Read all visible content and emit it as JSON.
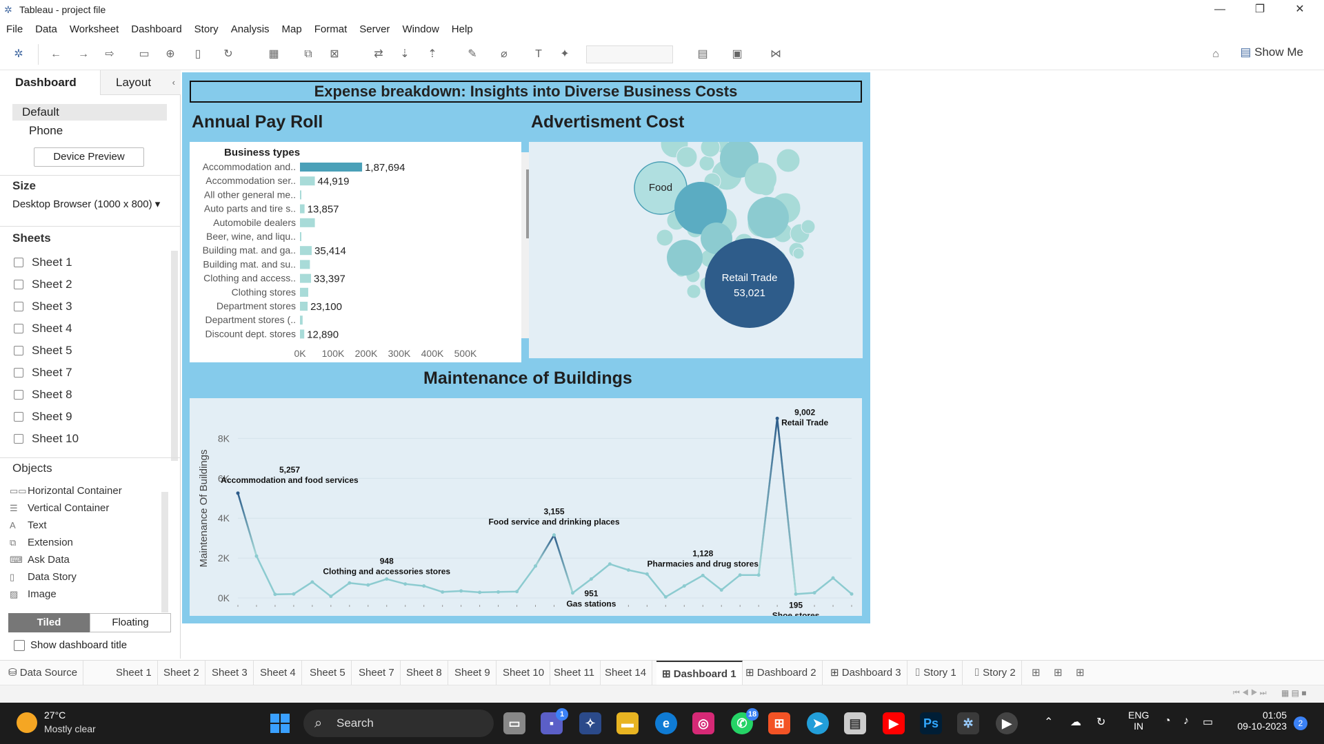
{
  "window": {
    "title": "Tableau - project file"
  },
  "menu": [
    "File",
    "Data",
    "Worksheet",
    "Dashboard",
    "Story",
    "Analysis",
    "Map",
    "Format",
    "Server",
    "Window",
    "Help"
  ],
  "toolbar": {
    "show_me": "Show Me"
  },
  "left_panel": {
    "tabs": [
      "Dashboard",
      "Layout"
    ],
    "devices": [
      "Default",
      "Phone"
    ],
    "device_preview": "Device Preview",
    "size_label": "Size",
    "size_value": "Desktop Browser (1000 x 800)",
    "sheets_label": "Sheets",
    "sheets": [
      "Sheet 1",
      "Sheet 2",
      "Sheet 3",
      "Sheet 4",
      "Sheet 5",
      "Sheet 7",
      "Sheet 8",
      "Sheet 9",
      "Sheet 10"
    ],
    "objects_label": "Objects",
    "objects": [
      {
        "icon": "horizontal-container-icon",
        "label": "Horizontal Container"
      },
      {
        "icon": "vertical-container-icon",
        "label": "Vertical Container"
      },
      {
        "icon": "text-icon",
        "label": "Text"
      },
      {
        "icon": "extension-icon",
        "label": "Extension"
      },
      {
        "icon": "ask-data-icon",
        "label": "Ask Data"
      },
      {
        "icon": "data-story-icon",
        "label": "Data Story"
      },
      {
        "icon": "image-icon",
        "label": "Image"
      }
    ],
    "tiled": "Tiled",
    "floating": "Floating",
    "show_title": "Show dashboard title"
  },
  "dashboard": {
    "title": "Expense breakdown: Insights into Diverse Business Costs",
    "chart1_title": "Annual Pay Roll",
    "chart2_title": "Advertisment Cost",
    "chart3_title": "Maintenance of Buildings"
  },
  "chart_data": [
    {
      "type": "bar",
      "title": "Annual Pay Roll",
      "header": "Business types",
      "categories": [
        "Accommodation and..",
        "Accommodation ser..",
        "All other general me..",
        "Auto parts and tire s..",
        "Automobile dealers",
        "Beer, wine, and liqu..",
        "Building mat. and ga..",
        "Building mat. and su..",
        "Clothing and access..",
        "Clothing stores",
        "Department stores",
        "Department stores (..",
        "Discount dept. stores"
      ],
      "values": [
        187694,
        44919,
        1500,
        13857,
        45000,
        500,
        35414,
        30000,
        33397,
        25000,
        23100,
        8000,
        12890
      ],
      "labels": [
        "1,87,694",
        "44,919",
        "",
        "13,857",
        "",
        "",
        "35,414",
        "",
        "33,397",
        "",
        "23,100",
        "",
        "12,890"
      ],
      "highlight_index": 0,
      "xticks": [
        "0K",
        "100K",
        "200K",
        "300K",
        "400K",
        "500K"
      ],
      "xlim": [
        0,
        500000
      ]
    },
    {
      "type": "bubble",
      "title": "Advertisment Cost",
      "labeled": [
        {
          "label": "Food",
          "value": ""
        },
        {
          "label": "Retail Trade",
          "value": "53,021"
        }
      ]
    },
    {
      "type": "line",
      "title": "Maintenance of Buildings",
      "ylabel": "Maintenance Of Buildings",
      "yticks": [
        "0K",
        "2K",
        "4K",
        "6K",
        "8K"
      ],
      "ylim": [
        0,
        9500
      ],
      "values": [
        5257,
        2100,
        180,
        200,
        800,
        80,
        750,
        650,
        948,
        700,
        600,
        300,
        350,
        280,
        300,
        320,
        1600,
        3155,
        250,
        951,
        1700,
        1400,
        1200,
        50,
        600,
        1128,
        400,
        1150,
        1150,
        9002,
        195,
        260,
        1000,
        200
      ],
      "annotations": [
        {
          "index": 0,
          "value": "5,257",
          "label": "Accommodation and food services"
        },
        {
          "index": 8,
          "value": "948",
          "label": "Clothing and accessories stores"
        },
        {
          "index": 17,
          "value": "3,155",
          "label": "Food service and drinking places"
        },
        {
          "index": 19,
          "value": "951",
          "label": "Gas stations"
        },
        {
          "index": 25,
          "value": "1,128",
          "label": "Pharmacies and drug stores"
        },
        {
          "index": 29,
          "value": "9,002",
          "label": "Retail Trade"
        },
        {
          "index": 30,
          "value": "195",
          "label": "Shoe stores"
        }
      ]
    }
  ],
  "bottom_tabs": [
    "Data Source",
    "Sheet 1",
    "Sheet 2",
    "Sheet 3",
    "Sheet 4",
    "Sheet 5",
    "Sheet 7",
    "Sheet 8",
    "Sheet 9",
    "Sheet 10",
    "Sheet 11",
    "Sheet 14",
    "Dashboard 1",
    "Dashboard 2",
    "Dashboard 3",
    "Story 1",
    "Story 2"
  ],
  "active_tab": "Dashboard 1",
  "taskbar": {
    "weather_temp": "27°C",
    "weather_desc": "Mostly clear",
    "search": "Search",
    "lang1": "ENG",
    "lang2": "IN",
    "time": "01:05",
    "date": "09-10-2023",
    "notif_count": "2",
    "teams_badge": "1",
    "whatsapp_badge": "18"
  }
}
